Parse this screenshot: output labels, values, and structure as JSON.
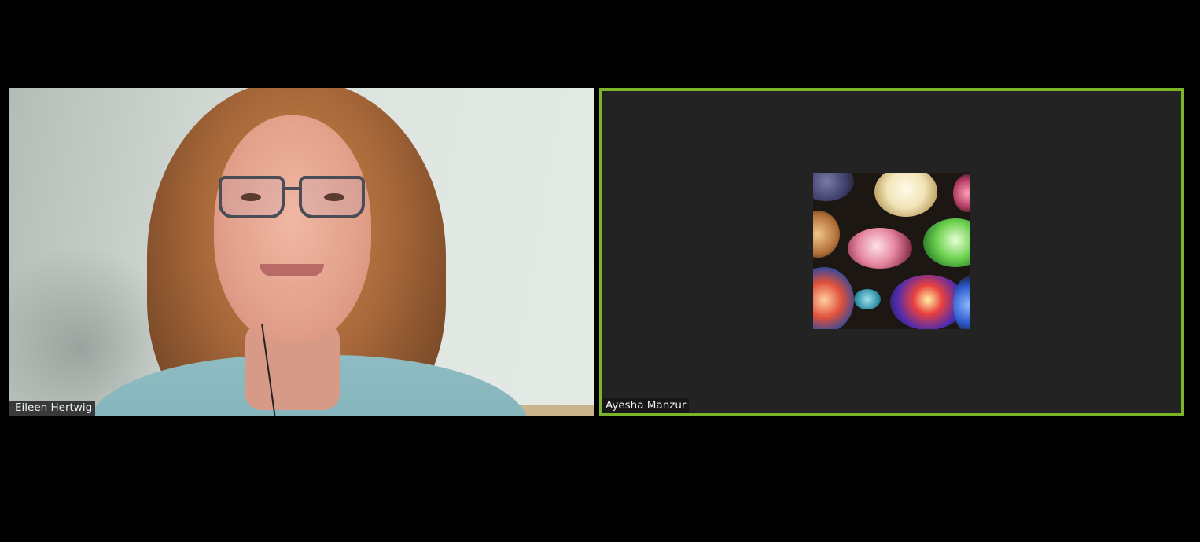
{
  "participants": [
    {
      "name": "Eileen Hertwig",
      "video": "webcam",
      "active_speaker": false
    },
    {
      "name": "Ayesha Manzur",
      "video": "avatar-lantern-photo",
      "active_speaker": true
    }
  ],
  "colors": {
    "background": "#000000",
    "tile_background": "#232323",
    "active_speaker_border": "#7ab52a",
    "name_tag_text": "#f2f2f2"
  }
}
